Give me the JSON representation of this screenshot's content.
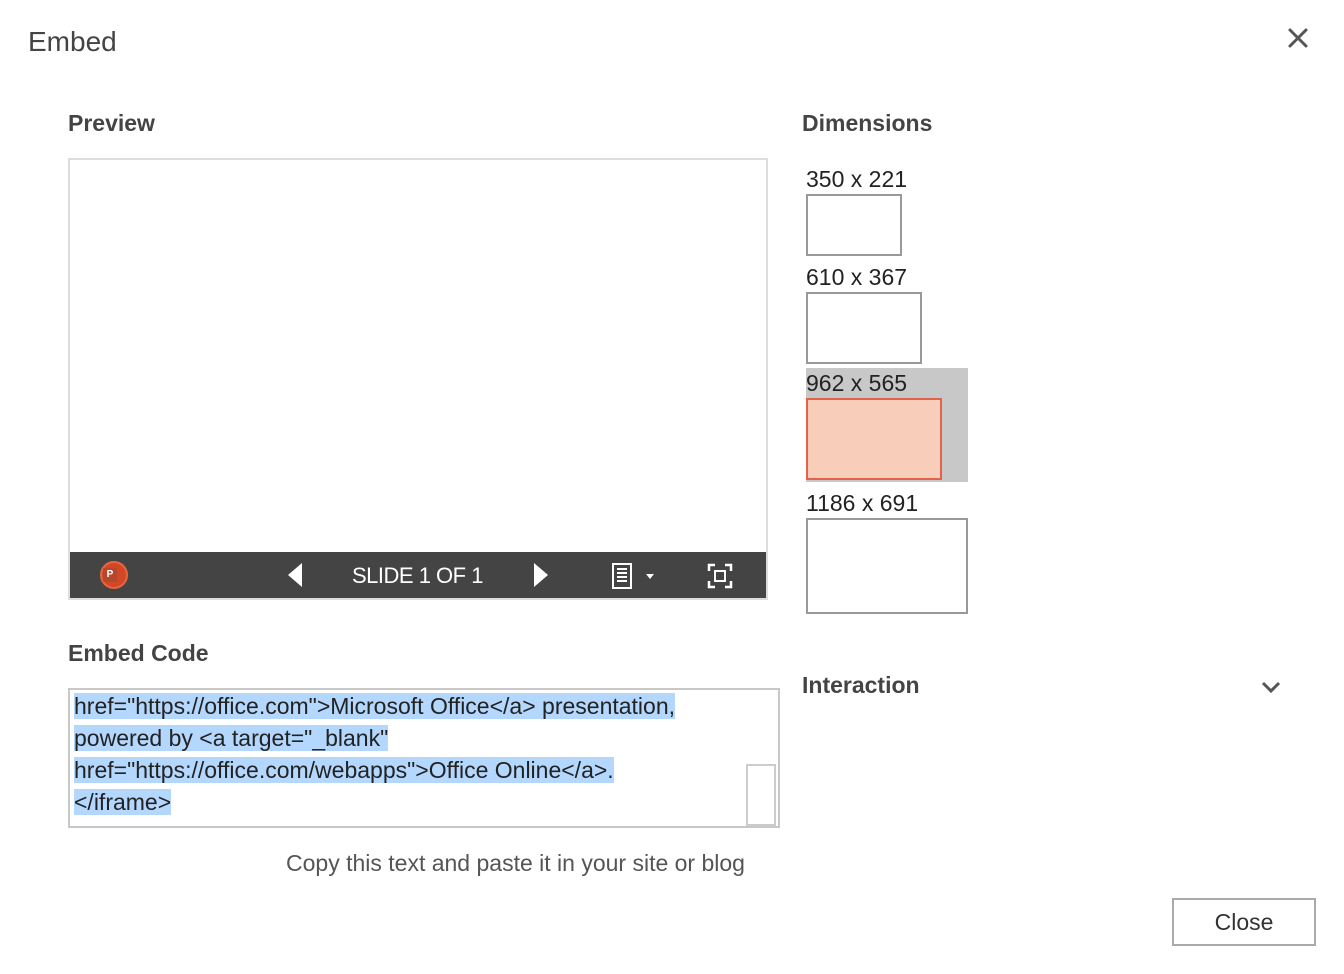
{
  "dialog": {
    "title": "Embed",
    "close_label": "Close"
  },
  "preview": {
    "heading": "Preview",
    "slide_counter": "SLIDE 1 OF 1",
    "app_badge": "P"
  },
  "dimensions": {
    "heading": "Dimensions",
    "options": [
      {
        "label": "350 x 221",
        "selected": false
      },
      {
        "label": "610 x 367",
        "selected": false
      },
      {
        "label": "962 x 565",
        "selected": true
      },
      {
        "label": "1186 x 691",
        "selected": false
      }
    ],
    "accent": "#e2634a",
    "selected_fill": "#f8cdb9"
  },
  "embed_code": {
    "heading": "Embed Code",
    "lines": [
      "href=\"https://office.com\">Microsoft Office</a> presentation,",
      "powered by <a target=\"_blank\"",
      "href=\"https://office.com/webapps\">Office Online</a>.",
      "</iframe>"
    ],
    "helper": "Copy this text and paste it in your site or blog",
    "selection_color": "#b4d7fe"
  },
  "interaction": {
    "heading": "Interaction"
  }
}
